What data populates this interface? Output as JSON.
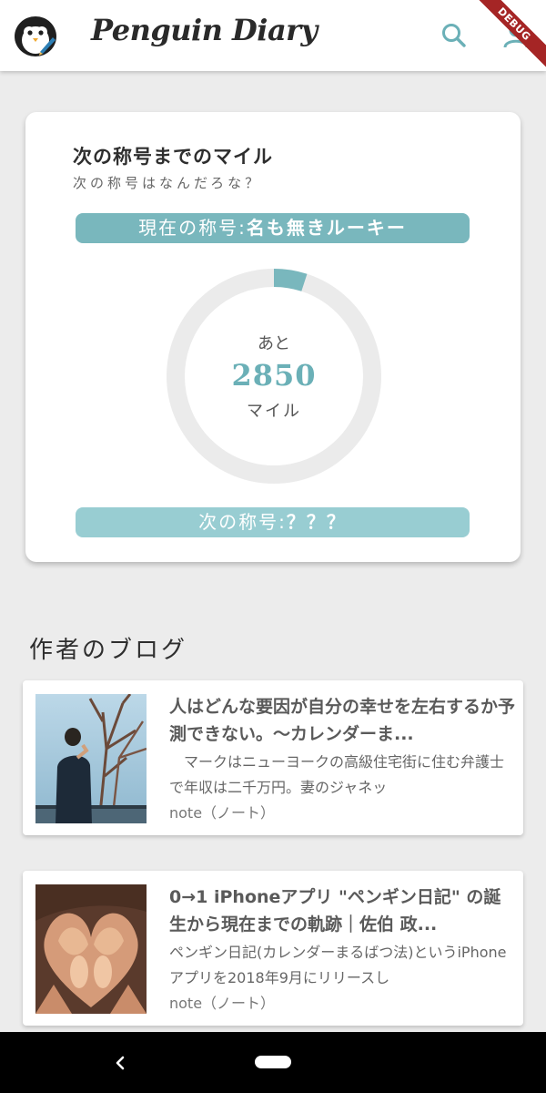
{
  "app": {
    "title": "Penguin Diary",
    "debug_label": "DEBUG",
    "icons": {
      "logo": "penguin-logo",
      "search": "search-icon",
      "profile": "person-icon"
    },
    "accent_color": "#6bb0b7"
  },
  "mileage_card": {
    "title": "次の称号までのマイル",
    "subtitle": "次の称号はなんだろな？",
    "current_title_label": "現在の称号:",
    "current_title_value": "名も無きルーキー",
    "remaining_prefix": "あと",
    "remaining_value": "2850",
    "remaining_unit": "マイル",
    "progress_fraction": 0.05,
    "next_title_label": "次の称号:",
    "next_title_value": "？？？"
  },
  "blog": {
    "section_title": "作者のブログ",
    "posts": [
      {
        "title": "人はどんな要因が自分の幸せを左右するか予測できない。〜カレンダーま...",
        "excerpt": "　マークはニューヨークの高級住宅街に住む弁護士で年収は二千万円。妻のジャネッ",
        "source": "note（ノート）",
        "thumbnail": "man-by-lake-photo"
      },
      {
        "title": "0→1 iPhoneアプリ \"ペンギン日記\" の誕生から現在までの軌跡｜佐伯 政...",
        "excerpt": " ペンギン日記(カレンダーまるばつ法)というiPhoneアプリを2018年9月にリリースし",
        "source": "note（ノート）",
        "thumbnail": "hands-heart-photo"
      }
    ]
  },
  "navigation": {
    "back_icon": "back-icon",
    "home_icon": "home-pill-icon"
  }
}
